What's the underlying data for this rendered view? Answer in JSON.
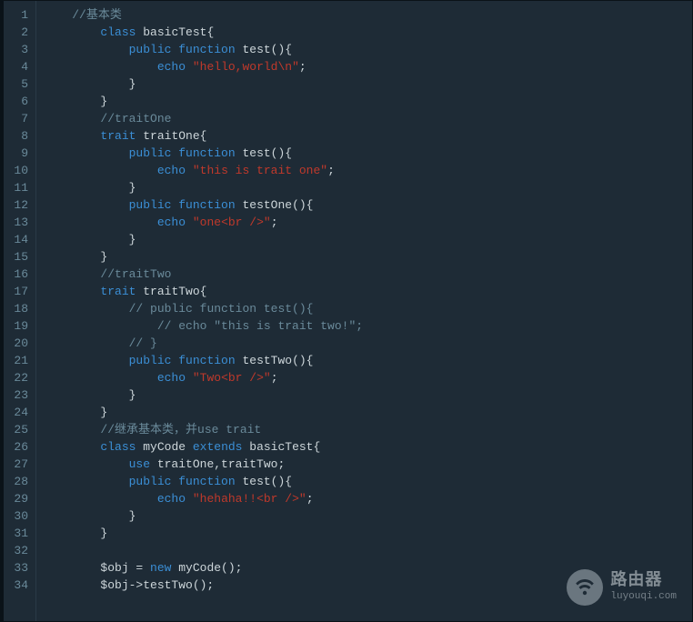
{
  "lineNumbers": [
    "1",
    "2",
    "3",
    "4",
    "5",
    "6",
    "7",
    "8",
    "9",
    "10",
    "11",
    "12",
    "13",
    "14",
    "15",
    "16",
    "17",
    "18",
    "19",
    "20",
    "21",
    "22",
    "23",
    "24",
    "25",
    "26",
    "27",
    "28",
    "29",
    "30",
    "31",
    "32",
    "33",
    "34"
  ],
  "code": [
    [
      [
        "    ",
        "plain"
      ],
      [
        "//基本类",
        "comment"
      ]
    ],
    [
      [
        "        ",
        "plain"
      ],
      [
        "class",
        "keyword"
      ],
      [
        " basicTest{",
        "plain"
      ]
    ],
    [
      [
        "            ",
        "plain"
      ],
      [
        "public",
        "keyword"
      ],
      [
        " ",
        "plain"
      ],
      [
        "function",
        "keyword"
      ],
      [
        " test(){",
        "plain"
      ]
    ],
    [
      [
        "                ",
        "plain"
      ],
      [
        "echo",
        "keyword"
      ],
      [
        " ",
        "plain"
      ],
      [
        "\"hello,world\\n\"",
        "string"
      ],
      [
        ";",
        "plain"
      ]
    ],
    [
      [
        "            }",
        "plain"
      ]
    ],
    [
      [
        "        }",
        "plain"
      ]
    ],
    [
      [
        "        ",
        "plain"
      ],
      [
        "//traitOne",
        "comment"
      ]
    ],
    [
      [
        "        ",
        "plain"
      ],
      [
        "trait",
        "keyword"
      ],
      [
        " traitOne{",
        "plain"
      ]
    ],
    [
      [
        "            ",
        "plain"
      ],
      [
        "public",
        "keyword"
      ],
      [
        " ",
        "plain"
      ],
      [
        "function",
        "keyword"
      ],
      [
        " test(){",
        "plain"
      ]
    ],
    [
      [
        "                ",
        "plain"
      ],
      [
        "echo",
        "keyword"
      ],
      [
        " ",
        "plain"
      ],
      [
        "\"this is trait one\"",
        "string"
      ],
      [
        ";",
        "plain"
      ]
    ],
    [
      [
        "            }",
        "plain"
      ]
    ],
    [
      [
        "            ",
        "plain"
      ],
      [
        "public",
        "keyword"
      ],
      [
        " ",
        "plain"
      ],
      [
        "function",
        "keyword"
      ],
      [
        " testOne(){",
        "plain"
      ]
    ],
    [
      [
        "                ",
        "plain"
      ],
      [
        "echo",
        "keyword"
      ],
      [
        " ",
        "plain"
      ],
      [
        "\"one<br />\"",
        "string"
      ],
      [
        ";",
        "plain"
      ]
    ],
    [
      [
        "            }",
        "plain"
      ]
    ],
    [
      [
        "        }",
        "plain"
      ]
    ],
    [
      [
        "        ",
        "plain"
      ],
      [
        "//traitTwo",
        "comment"
      ]
    ],
    [
      [
        "        ",
        "plain"
      ],
      [
        "trait",
        "keyword"
      ],
      [
        " traitTwo{",
        "plain"
      ]
    ],
    [
      [
        "            ",
        "plain"
      ],
      [
        "// public function test(){",
        "comment"
      ]
    ],
    [
      [
        "                ",
        "plain"
      ],
      [
        "// echo \"this is trait two!\";",
        "comment"
      ]
    ],
    [
      [
        "            ",
        "plain"
      ],
      [
        "// }",
        "comment"
      ]
    ],
    [
      [
        "            ",
        "plain"
      ],
      [
        "public",
        "keyword"
      ],
      [
        " ",
        "plain"
      ],
      [
        "function",
        "keyword"
      ],
      [
        " testTwo(){",
        "plain"
      ]
    ],
    [
      [
        "                ",
        "plain"
      ],
      [
        "echo",
        "keyword"
      ],
      [
        " ",
        "plain"
      ],
      [
        "\"Two<br />\"",
        "string"
      ],
      [
        ";",
        "plain"
      ]
    ],
    [
      [
        "            }",
        "plain"
      ]
    ],
    [
      [
        "        }",
        "plain"
      ]
    ],
    [
      [
        "        ",
        "plain"
      ],
      [
        "//继承基本类，并use trait",
        "comment"
      ]
    ],
    [
      [
        "        ",
        "plain"
      ],
      [
        "class",
        "keyword"
      ],
      [
        " myCode ",
        "plain"
      ],
      [
        "extends",
        "keyword"
      ],
      [
        " basicTest{",
        "plain"
      ]
    ],
    [
      [
        "            ",
        "plain"
      ],
      [
        "use",
        "keyword"
      ],
      [
        " traitOne,traitTwo;",
        "plain"
      ]
    ],
    [
      [
        "            ",
        "plain"
      ],
      [
        "public",
        "keyword"
      ],
      [
        " ",
        "plain"
      ],
      [
        "function",
        "keyword"
      ],
      [
        " test(){",
        "plain"
      ]
    ],
    [
      [
        "                ",
        "plain"
      ],
      [
        "echo",
        "keyword"
      ],
      [
        " ",
        "plain"
      ],
      [
        "\"hehaha!!<br />\"",
        "string"
      ],
      [
        ";",
        "plain"
      ]
    ],
    [
      [
        "            }",
        "plain"
      ]
    ],
    [
      [
        "        }",
        "plain"
      ]
    ],
    [
      [
        "",
        "plain"
      ]
    ],
    [
      [
        "        $obj = ",
        "plain"
      ],
      [
        "new",
        "keyword"
      ],
      [
        " myCode();",
        "plain"
      ]
    ],
    [
      [
        "        $obj->testTwo();",
        "plain"
      ]
    ]
  ],
  "watermark": {
    "title": "路由器",
    "sub": "luyouqi.com"
  }
}
